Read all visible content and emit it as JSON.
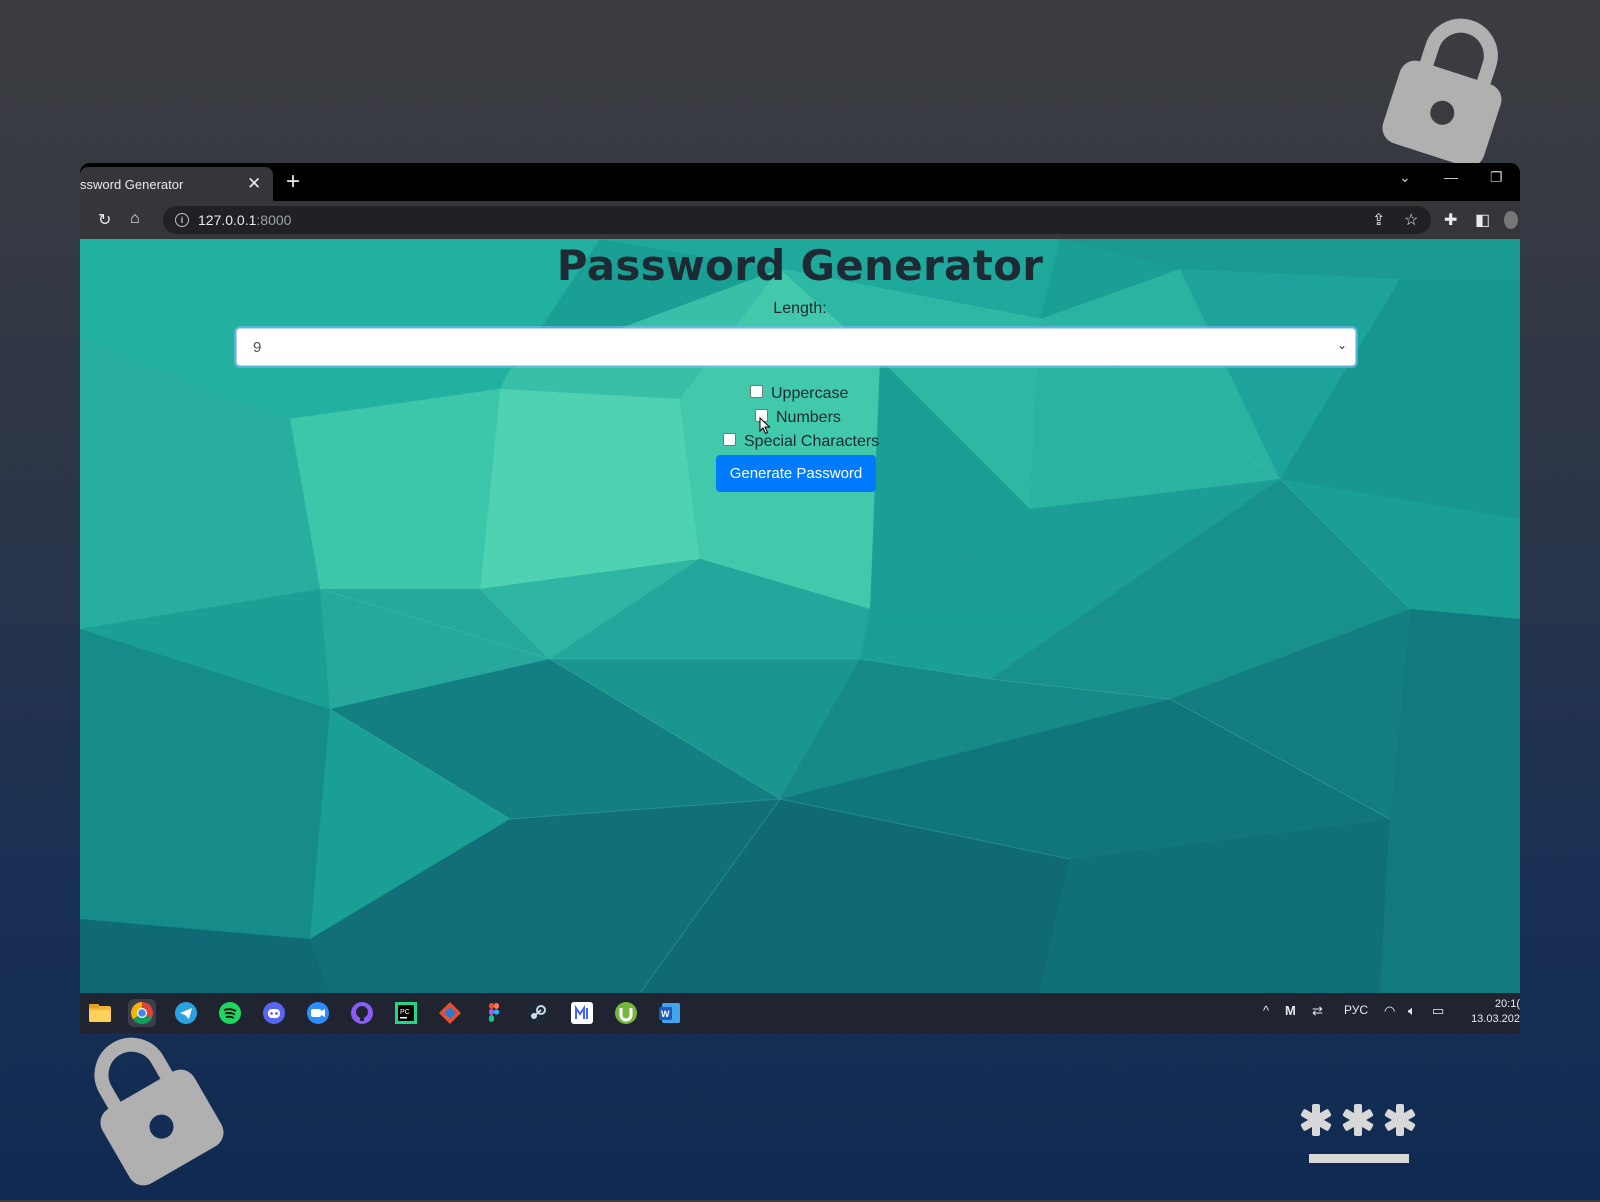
{
  "browser": {
    "tab_title": "ssword Generator",
    "tab_close": "✕",
    "new_tab": "+",
    "url_host": "127.0.0.1",
    "url_port": ":8000",
    "win_controls": [
      "⌄",
      "—",
      "❐"
    ]
  },
  "page": {
    "title": "Password Generator",
    "length_label": "Length:",
    "length_value": "9",
    "options": [
      {
        "label": "Uppercase",
        "checked": false
      },
      {
        "label": "Numbers",
        "checked": false
      },
      {
        "label": "Special Characters",
        "checked": false
      }
    ],
    "generate_label": "Generate Password"
  },
  "taskbar": {
    "apps": [
      "file-explorer",
      "chrome",
      "telegram",
      "spotify",
      "discord",
      "zoom",
      "github",
      "pycharm",
      "sourcetree",
      "figma",
      "steam",
      "miro",
      "utorrent",
      "word"
    ],
    "language": "РУС",
    "time": "20:1(",
    "date": "13.03.202"
  },
  "colors": {
    "button": "#007bff",
    "background_teal": "#1a9f95",
    "lock_gray": "#b0b0b0"
  }
}
